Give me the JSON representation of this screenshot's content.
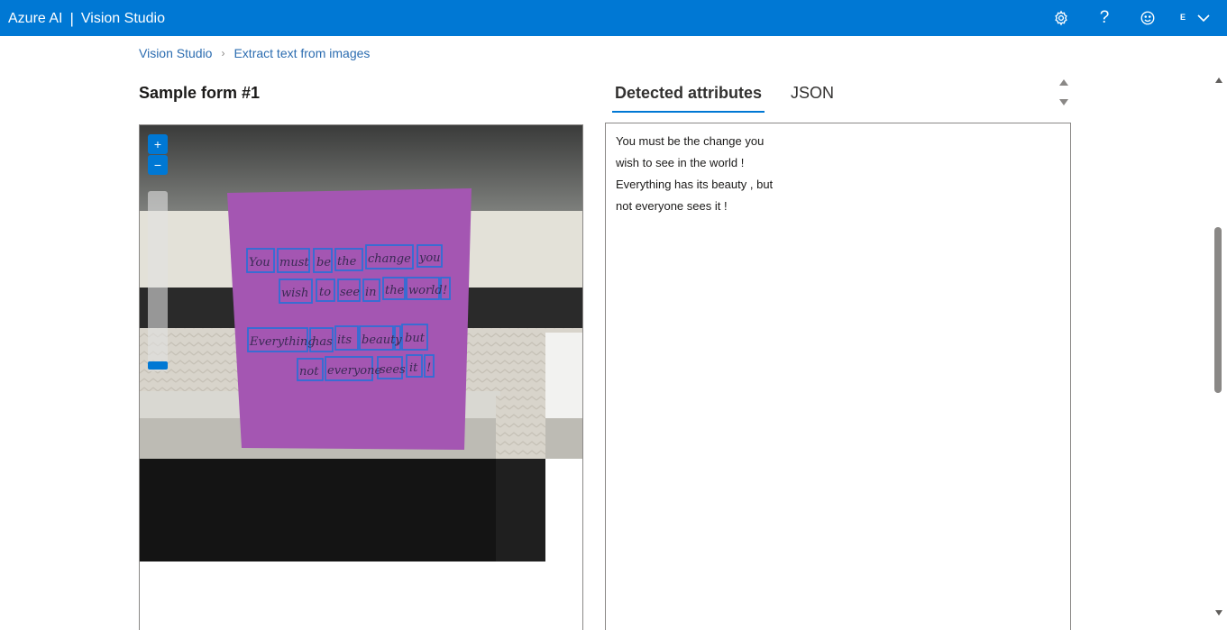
{
  "header": {
    "brand": "Azure AI",
    "separator": "|",
    "product": "Vision Studio",
    "avatar_initial": "E",
    "icons": [
      "gear-icon",
      "help-icon",
      "feedback-smiley-icon",
      "chevron-down-icon"
    ],
    "color": "#0078d4"
  },
  "breadcrumb": {
    "items": [
      "Vision Studio",
      "Extract text from images"
    ]
  },
  "sample": {
    "title": "Sample form #1"
  },
  "tabs": [
    {
      "label": "Detected attributes",
      "active": true
    },
    {
      "label": "JSON",
      "active": false
    }
  ],
  "image_viewer": {
    "zoom_in": "+",
    "zoom_out": "−"
  },
  "detected_text": {
    "lines": [
      "You must be the change you",
      "wish to see in the world !",
      "Everything has its beauty , but",
      "not everyone sees it !"
    ]
  }
}
